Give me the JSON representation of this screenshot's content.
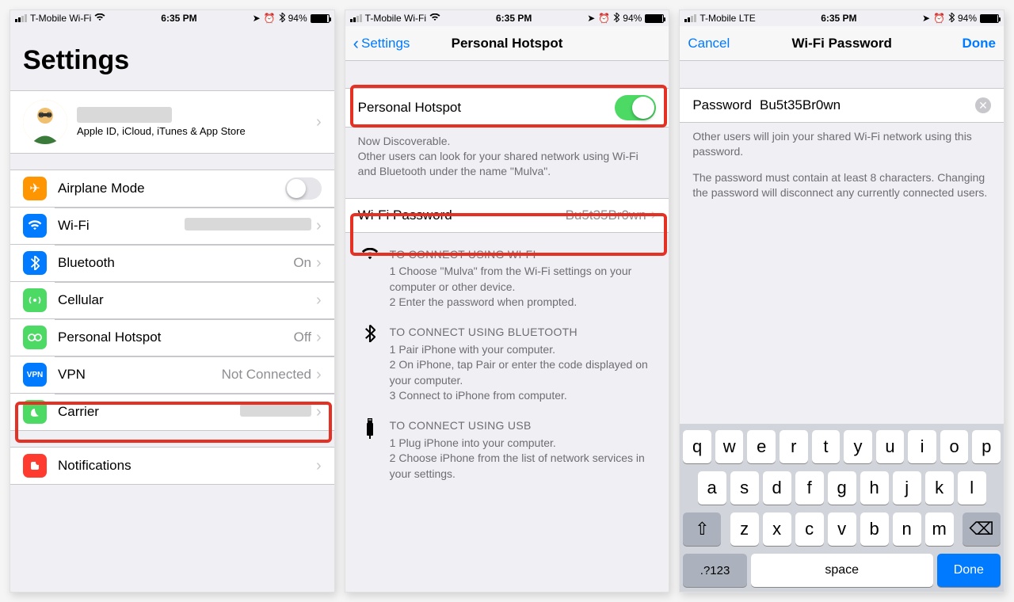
{
  "status": {
    "carrier_wifi": "T-Mobile Wi-Fi",
    "carrier_lte": "T-Mobile  LTE",
    "time": "6:35 PM",
    "battery_pct": "94%"
  },
  "screen1": {
    "title": "Settings",
    "profile": {
      "subtitle": "Apple ID, iCloud, iTunes & App Store"
    },
    "rows": {
      "airplane": {
        "label": "Airplane Mode"
      },
      "wifi": {
        "label": "Wi-Fi"
      },
      "bluetooth": {
        "label": "Bluetooth",
        "value": "On"
      },
      "cellular": {
        "label": "Cellular"
      },
      "hotspot": {
        "label": "Personal Hotspot",
        "value": "Off"
      },
      "vpn": {
        "label": "VPN",
        "value": "Not Connected"
      },
      "carrier": {
        "label": "Carrier"
      },
      "notifications": {
        "label": "Notifications"
      }
    }
  },
  "screen2": {
    "back": "Settings",
    "title": "Personal Hotspot",
    "toggle_label": "Personal Hotspot",
    "discoverable_title": "Now Discoverable.",
    "discoverable_body": "Other users can look for your shared network using Wi-Fi and Bluetooth under the name \"Mulva\".",
    "wifi_pw_label": "Wi-Fi Password",
    "wifi_pw_value": "Bu5t35Br0wn",
    "connect_wifi": {
      "title": "TO CONNECT USING WI-FI",
      "l1": "1 Choose \"Mulva\" from the Wi-Fi settings on your computer or other device.",
      "l2": "2 Enter the password when prompted."
    },
    "connect_bt": {
      "title": "TO CONNECT USING BLUETOOTH",
      "l1": "1 Pair iPhone with your computer.",
      "l2": "2 On iPhone, tap Pair or enter the code displayed on your computer.",
      "l3": "3 Connect to iPhone from computer."
    },
    "connect_usb": {
      "title": "TO CONNECT USING USB",
      "l1": "1 Plug iPhone into your computer.",
      "l2": "2 Choose iPhone from the list of network services in your settings."
    }
  },
  "screen3": {
    "cancel": "Cancel",
    "title": "Wi-Fi Password",
    "done": "Done",
    "pw_label": "Password",
    "pw_value": "Bu5t35Br0wn",
    "footer1": "Other users will join your shared Wi-Fi network using this password.",
    "footer2": "The password must contain at least 8 characters. Changing the password will disconnect any currently connected users."
  },
  "keyboard": {
    "row1": [
      "q",
      "w",
      "e",
      "r",
      "t",
      "y",
      "u",
      "i",
      "o",
      "p"
    ],
    "row2": [
      "a",
      "s",
      "d",
      "f",
      "g",
      "h",
      "j",
      "k",
      "l"
    ],
    "row3": [
      "z",
      "x",
      "c",
      "v",
      "b",
      "n",
      "m"
    ],
    "mode": ".?123",
    "space": "space",
    "done": "Done"
  },
  "icon_colors": {
    "airplane": "#ff9500",
    "wifi": "#007aff",
    "bluetooth": "#007aff",
    "cellular": "#4cd964",
    "hotspot": "#4cd964",
    "vpn": "#007aff",
    "carrier": "#4cd964",
    "notifications": "#ff3b30"
  }
}
